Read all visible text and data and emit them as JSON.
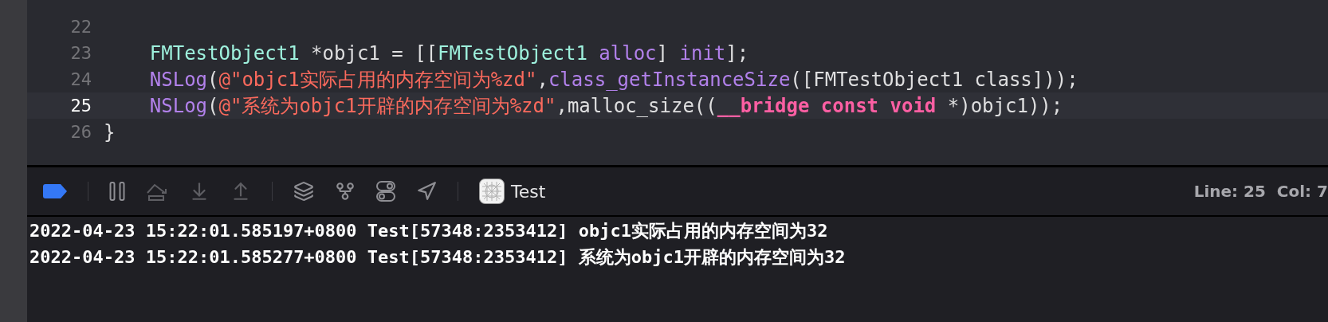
{
  "editor": {
    "lines": [
      {
        "number": "22",
        "current": false
      },
      {
        "number": "23",
        "current": false,
        "tokens": [
          {
            "kind": "type",
            "text": "    FMTestObject1"
          },
          {
            "kind": "plain",
            "text": " *objc1 = [["
          },
          {
            "kind": "type",
            "text": "FMTestObject1"
          },
          {
            "kind": "method",
            "text": " alloc"
          },
          {
            "kind": "plain",
            "text": "] "
          },
          {
            "kind": "method",
            "text": "init"
          },
          {
            "kind": "plain",
            "text": "];"
          }
        ]
      },
      {
        "number": "24",
        "current": false,
        "tokens": [
          {
            "kind": "method",
            "text": "    NSLog"
          },
          {
            "kind": "plain",
            "text": "("
          },
          {
            "kind": "string",
            "text": "@\"objc1实际占用的内存空间为%zd\""
          },
          {
            "kind": "plain",
            "text": ","
          },
          {
            "kind": "method",
            "text": "class_getInstanceSize"
          },
          {
            "kind": "plain",
            "text": "([FMTestObject1 class]));"
          }
        ]
      },
      {
        "number": "25",
        "current": true,
        "tokens": [
          {
            "kind": "method",
            "text": "    NSLog"
          },
          {
            "kind": "plain",
            "text": "("
          },
          {
            "kind": "string",
            "text": "@\"系统为objc1开辟的内存空间为%zd\""
          },
          {
            "kind": "plain",
            "text": ",malloc_size(("
          },
          {
            "kind": "keyword",
            "text": "__bridge"
          },
          {
            "kind": "keyword",
            "text": " const"
          },
          {
            "kind": "keyword",
            "text": " void"
          },
          {
            "kind": "plain",
            "text": " *)objc1));"
          }
        ]
      },
      {
        "number": "26",
        "current": false,
        "tokens": [
          {
            "kind": "plain",
            "text": "}"
          }
        ]
      }
    ]
  },
  "debug_bar": {
    "breakpoints_active": true,
    "scheme": "Test",
    "line": "Line: 25",
    "column": "Col: 7"
  },
  "console": {
    "lines": [
      "2022-04-23 15:22:01.585197+0800 Test[57348:2353412] objc1实际占用的内存空间为32",
      "2022-04-23 15:22:01.585277+0800 Test[57348:2353412] 系统为objc1开辟的内存空间为32"
    ]
  }
}
